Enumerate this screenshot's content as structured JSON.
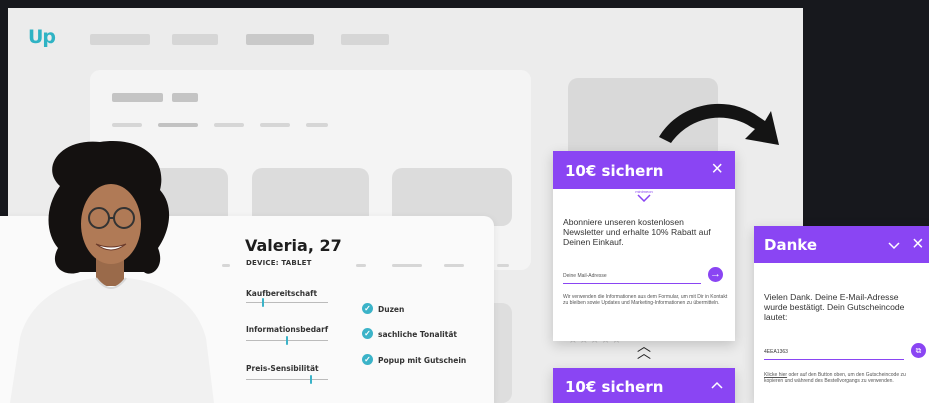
{
  "logo": {
    "text": "Up"
  },
  "persona": {
    "name": "Valeria, 27",
    "device": "DEVICE: TABLET",
    "sliders": [
      {
        "label": "Kaufbereitschaft",
        "value": 0.2
      },
      {
        "label": "Informationsbedarf",
        "value": 0.5
      },
      {
        "label": "Preis-Sensibilität",
        "value": 0.78
      }
    ],
    "checks": [
      {
        "label": "Duzen"
      },
      {
        "label": "sachliche Tonalität"
      },
      {
        "label": "Popup mit Gutschein"
      }
    ]
  },
  "popup": {
    "title": "10€ sichern",
    "brand": "minimeon",
    "text": "Abonniere unseren kostenlosen Newsletter und erhalte 10% Rabatt auf Deinen Einkauf.",
    "email_placeholder": "Deine Mail-Adresse",
    "disclaimer": "Wir verwenden die Informationen aus dem Formular, um mit Dir in Kontakt zu bleiben sowie Updates und Marketing-Informationen zu übermitteln."
  },
  "collapsed": {
    "title": "10€ sichern"
  },
  "thanks": {
    "title": "Danke",
    "text": "Vielen Dank. Deine E-Mail-Adresse wurde bestätigt. Dein Gutscheincode lautet:",
    "code": "4EEA1363",
    "hint_link": "Klicke hier",
    "hint_rest": " oder auf den Button oben, um den Gutscheincode zu kopieren und während des Bestellvorgangs zu verwenden."
  },
  "colors": {
    "accent": "#8a45f3",
    "brand": "#2fb3c4",
    "bg": "#17181d"
  }
}
